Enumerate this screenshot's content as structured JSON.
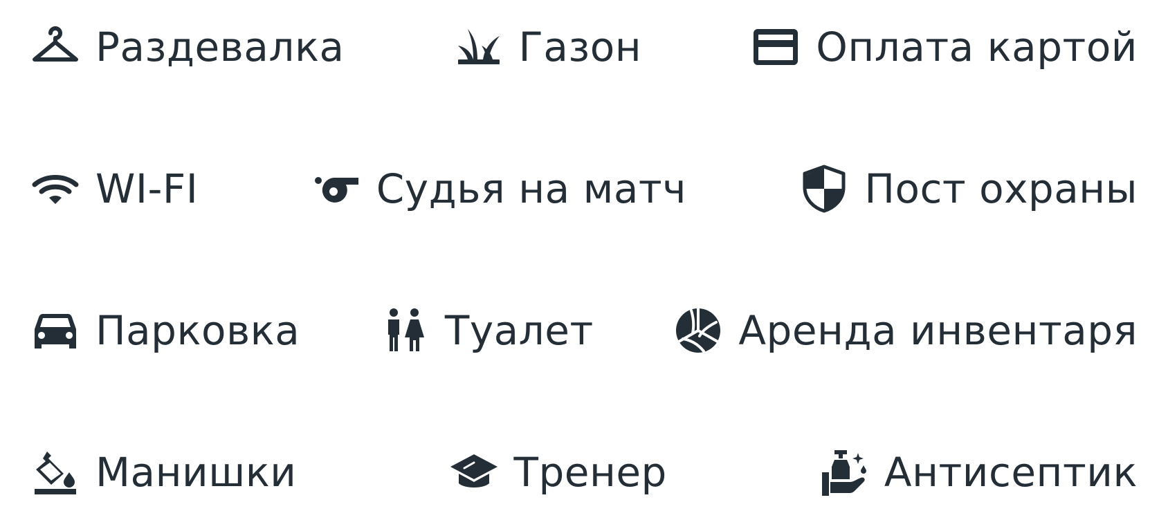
{
  "colors": {
    "ink": "#242e37",
    "background": "#ffffff"
  },
  "amenities": [
    [
      {
        "label": "Раздевалка",
        "icon": "hanger-icon"
      },
      {
        "label": "Газон",
        "icon": "grass-icon"
      },
      {
        "label": "Оплата картой",
        "icon": "credit-card-icon"
      }
    ],
    [
      {
        "label": "WI-FI",
        "icon": "wifi-icon"
      },
      {
        "label": "Судья на матч",
        "icon": "whistle-icon"
      },
      {
        "label": "Пост охраны",
        "icon": "shield-icon"
      }
    ],
    [
      {
        "label": "Парковка",
        "icon": "car-icon"
      },
      {
        "label": "Туалет",
        "icon": "restroom-icon"
      },
      {
        "label": "Аренда инвентаря",
        "icon": "volleyball-icon"
      }
    ],
    [
      {
        "label": "Манишки",
        "icon": "paint-bucket-icon"
      },
      {
        "label": "Тренер",
        "icon": "graduation-cap-icon"
      },
      {
        "label": "Антисептик",
        "icon": "hand-soap-icon"
      }
    ]
  ]
}
